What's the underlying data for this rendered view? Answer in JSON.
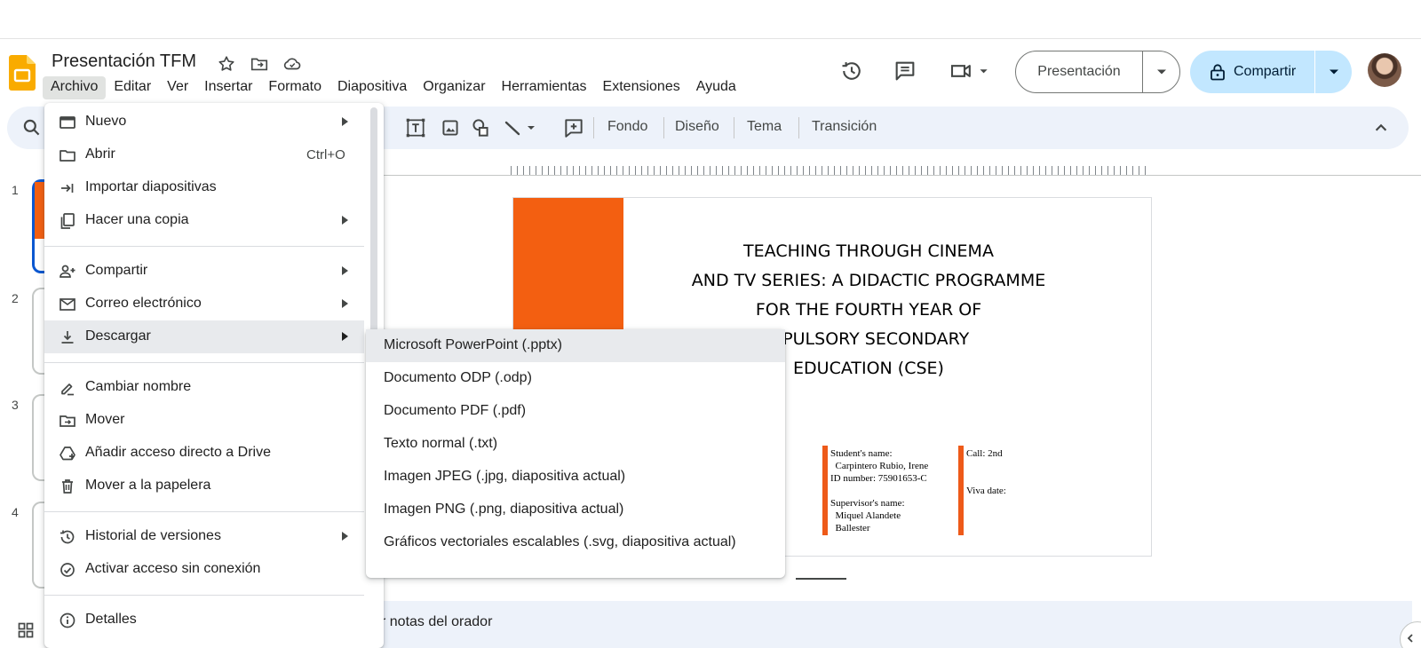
{
  "app": {
    "document_title": "Presentación TFM",
    "menubar": [
      "Archivo",
      "Editar",
      "Ver",
      "Insertar",
      "Formato",
      "Diapositiva",
      "Organizar",
      "Herramientas",
      "Extensiones",
      "Ayuda"
    ],
    "active_menu": "Archivo"
  },
  "header": {
    "present_label": "Presentación",
    "share_label": "Compartir"
  },
  "toolbar": {
    "background_label": "Fondo",
    "layout_label": "Diseño",
    "theme_label": "Tema",
    "transition_label": "Transición"
  },
  "file_menu": {
    "new": "Nuevo",
    "open": "Abrir",
    "open_shortcut": "Ctrl+O",
    "import_slides": "Importar diapositivas",
    "make_copy": "Hacer una copia",
    "share": "Compartir",
    "email": "Correo electrónico",
    "download": "Descargar",
    "rename": "Cambiar nombre",
    "move": "Mover",
    "add_shortcut": "Añadir acceso directo a Drive",
    "trash": "Mover a la papelera",
    "version_history": "Historial de versiones",
    "offline": "Activar acceso sin conexión",
    "details": "Detalles"
  },
  "download_menu": {
    "pptx": "Microsoft PowerPoint (.pptx)",
    "odp": "Documento ODP (.odp)",
    "pdf": "Documento PDF (.pdf)",
    "txt": "Texto normal (.txt)",
    "jpg": "Imagen JPEG (.jpg, diapositiva actual)",
    "png": "Imagen PNG (.png, diapositiva actual)",
    "svg": "Gráficos vectoriales escalables (.svg, diapositiva actual)"
  },
  "slide": {
    "title_lines": [
      "TEACHING THROUGH CINEMA",
      "AND TV SERIES: A DIDACTIC PROGRAMME",
      "FOR THE FOURTH YEAR OF",
      "MPULSORY SECONDARY",
      "EDUCATION (CSE)"
    ],
    "student_info": "Student's name:\n  Carpintero Rubio, Irene\nID number: 75901653-C\n\nSupervisor's name:\n  Miquel Alandete\n  Ballester",
    "call_info": "Call: 2nd\n\n\nViva date:",
    "accent_color": "#F35F11"
  },
  "filmstrip": {
    "slide_numbers": [
      "1",
      "2",
      "3",
      "4"
    ]
  },
  "notes": {
    "placeholder_visible": "r notas del orador"
  },
  "colors": {
    "share_button": "#C2E7FF",
    "selection_blue": "#0B57D0",
    "toolbar_bg": "#EDF2FA"
  }
}
